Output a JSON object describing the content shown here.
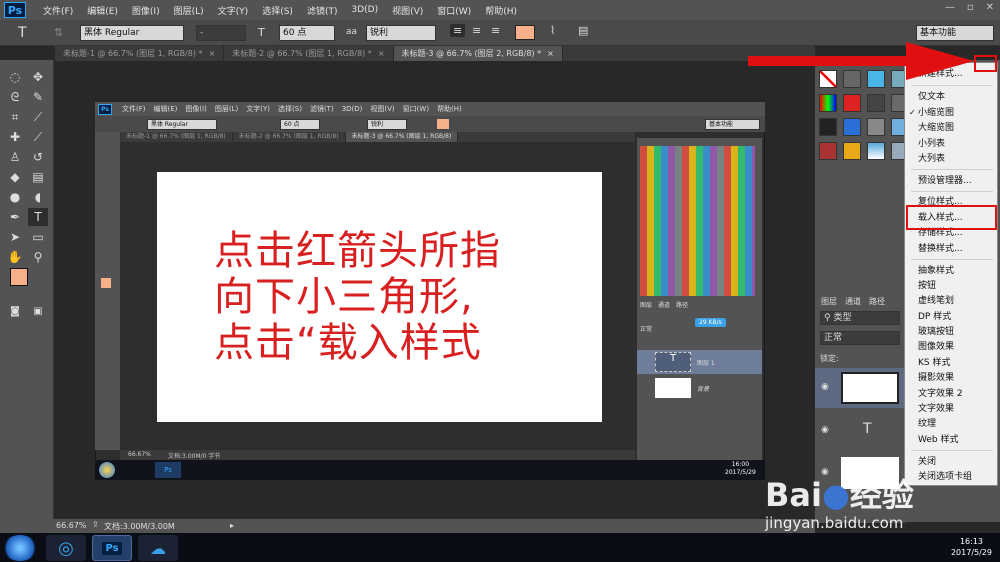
{
  "app": {
    "logo": "Ps"
  },
  "menubar": {
    "items": [
      "文件(F)",
      "编辑(E)",
      "图像(I)",
      "图层(L)",
      "文字(Y)",
      "选择(S)",
      "滤镜(T)",
      "3D(D)",
      "视图(V)",
      "窗口(W)",
      "帮助(H)"
    ]
  },
  "options": {
    "font_family": "黑体 Regular",
    "font_style": "-",
    "font_size": "60 点",
    "aa_label": "aa",
    "aa_mode": "锐利",
    "workspace": "基本功能",
    "text_color": "#f8b08a"
  },
  "tabs": [
    {
      "label": "未标题-1 @ 66.7% (图层 1, RGB/8) *"
    },
    {
      "label": "未标题-2 @ 66.7% (图层 1, RGB/8) *"
    },
    {
      "label": "未标题-3 @ 66.7% (图层 2, RGB/8) *"
    }
  ],
  "inner": {
    "menu": [
      "文件(F)",
      "编辑(E)",
      "图像(I)",
      "图层(L)",
      "文字(Y)",
      "选择(S)",
      "滤镜(T)",
      "3D(D)",
      "视图(V)",
      "窗口(W)",
      "帮助(H)"
    ],
    "font_family": "黑体 Regular",
    "font_size": "60 点",
    "aa_mode": "锐利",
    "workspace": "基本功能",
    "tabs": [
      "未标题-1 @ 66.7% (图层 1, RGB/8)",
      "未标题-2 @ 66.7% (图层 1, RGB/8)",
      "未标题-3 @ 66.7% (图层 1, RGB/8)"
    ],
    "status_zoom": "66.67%",
    "status_doc": "文档:3.00M/0 字节",
    "panel_tabs": [
      "图层",
      "通道",
      "路径"
    ],
    "blend": "正常",
    "layer1": "图层 1",
    "layer2": "背景",
    "speed": "29 KB/s",
    "time": "16:00",
    "date": "2017/5/29"
  },
  "main_text": {
    "line1": "点击红箭头所指",
    "line2": "向下小三角形,",
    "line3": "点击“载入样式"
  },
  "layers_panel": {
    "tabs": [
      "图层",
      "通道",
      "路径"
    ],
    "kind": "类型",
    "blend": "正常",
    "lock": "锁定:"
  },
  "flyout_menu": {
    "groups": [
      [
        "新建样式..."
      ],
      [
        "仅文本",
        "小缩览图",
        "大缩览图",
        "小列表",
        "大列表"
      ],
      [
        "预设管理器..."
      ],
      [
        "复位样式...",
        "载入样式...",
        "存储样式...",
        "替换样式..."
      ],
      [
        "抽象样式",
        "按钮",
        "虚线笔划",
        "DP 样式",
        "玻璃按钮",
        "图像效果",
        "KS 样式",
        "摄影效果",
        "文字效果 2",
        "文字效果",
        "纹理",
        "Web 样式"
      ],
      [
        "关闭",
        "关闭选项卡组"
      ]
    ],
    "checked": "小缩览图"
  },
  "status": {
    "zoom": "66.67%",
    "doc": "文档:3.00M/3.00M"
  },
  "taskbar": {
    "time": "16:13",
    "date": "2017/5/29"
  },
  "watermark": {
    "brand": "Bai",
    "brand2": "经验",
    "url": "jingyan.baidu.com"
  },
  "colors": {
    "annotation_red": "#e01010",
    "text_red": "#d92020",
    "swatch_fg": "#f8b08a"
  }
}
